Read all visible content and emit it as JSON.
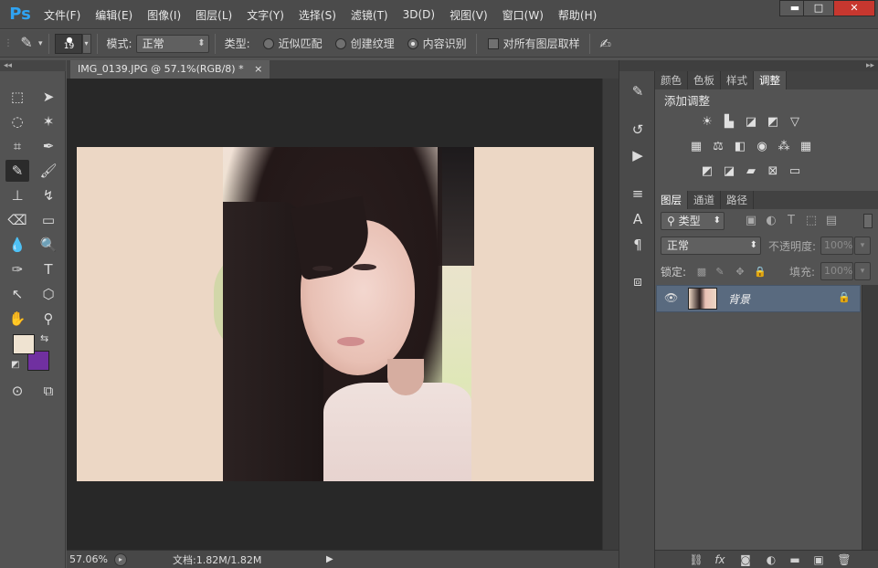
{
  "app": {
    "logo": "Ps"
  },
  "menubar": {
    "items": [
      "文件(F)",
      "编辑(E)",
      "图像(I)",
      "图层(L)",
      "文字(Y)",
      "选择(S)",
      "滤镜(T)",
      "3D(D)",
      "视图(V)",
      "窗口(W)",
      "帮助(H)"
    ]
  },
  "window_controls": {
    "minimize": "▬",
    "maximize": "□",
    "close": "✕"
  },
  "options_bar": {
    "brush_size": "19",
    "mode_label": "模式:",
    "mode_value": "正常",
    "type_label": "类型:",
    "type_options": [
      "近似匹配",
      "创建纹理",
      "内容识别"
    ],
    "selected_type": "内容识别",
    "sample_all_label": "对所有图层取样"
  },
  "document": {
    "tab_title": "IMG_0139.JPG @ 57.1%(RGB/8) *",
    "tab_close": "×"
  },
  "statusbar": {
    "zoom": "57.06%",
    "doc_info": "文档:1.82M/1.82M"
  },
  "colors": {
    "foreground": "#efe3d1",
    "background": "#7030a0",
    "accent": "#2fa3f2",
    "selected_layer": "#596a7f"
  },
  "panels": {
    "top_tabs": [
      "颜色",
      "色板",
      "样式",
      "调整"
    ],
    "active_top_tab": "调整",
    "adjustments_title": "添加调整",
    "layers_tabs": [
      "图层",
      "通道",
      "路径"
    ],
    "active_layers_tab": "图层",
    "filter_kind": "类型",
    "blend_mode": "正常",
    "opacity_label": "不透明度:",
    "opacity_value": "100%",
    "lock_label": "锁定:",
    "fill_label": "填充:",
    "fill_value": "100%",
    "layers": [
      {
        "name": "背景",
        "visible": true,
        "locked": true
      }
    ]
  },
  "icons": {
    "layer_visibility": "eye-icon",
    "layer_lock": "lock-icon"
  }
}
